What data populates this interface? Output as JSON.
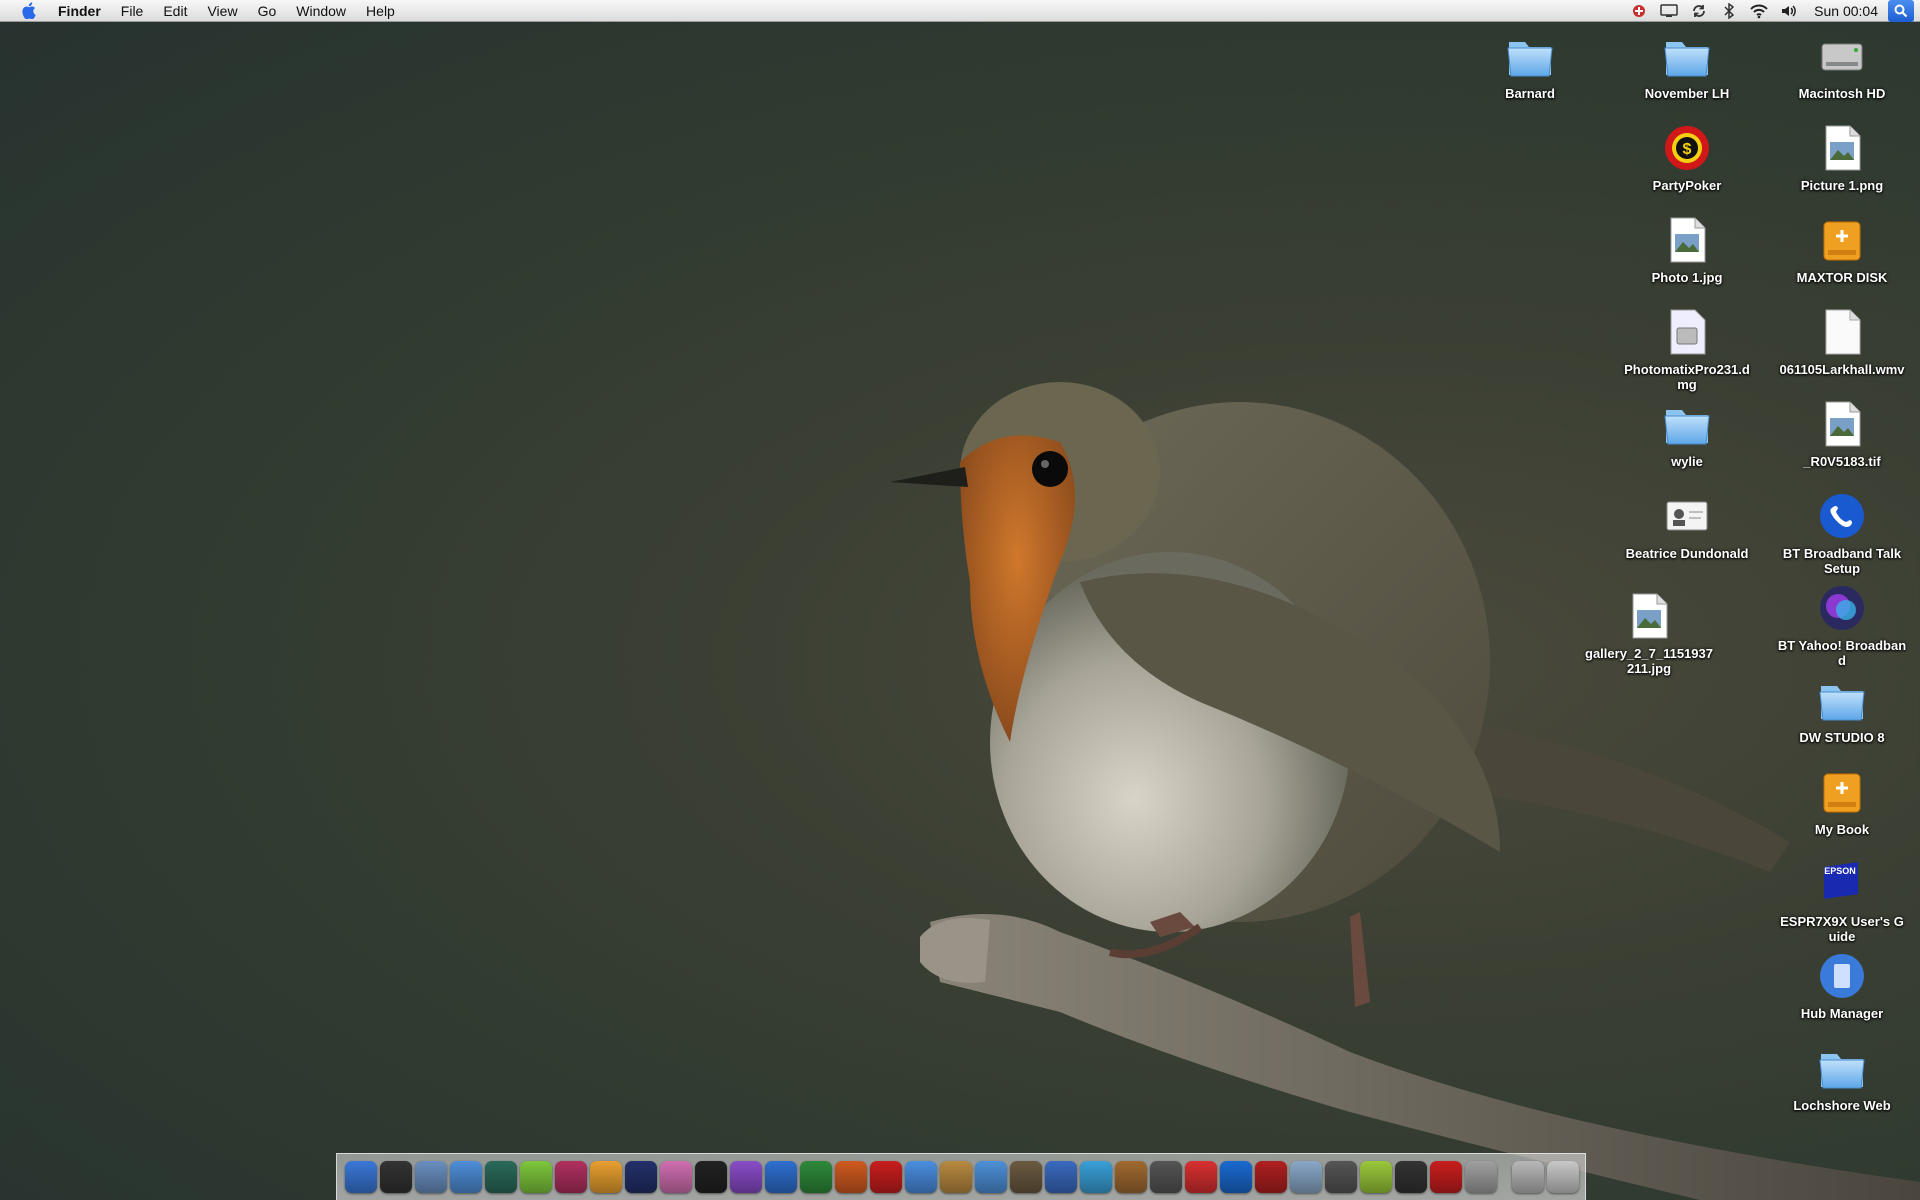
{
  "menubar": {
    "app_name": "Finder",
    "menus": [
      "File",
      "Edit",
      "View",
      "Go",
      "Window",
      "Help"
    ],
    "clock": "Sun 00:04",
    "status_icons": [
      "dashboard-status-icon",
      "display-icon",
      "sync-icon",
      "bluetooth-icon",
      "wifi-icon",
      "volume-icon"
    ]
  },
  "desktop_icons": [
    {
      "label": "Barnard",
      "icon": "folder-icon"
    },
    {
      "label": "November LH",
      "icon": "folder-icon"
    },
    {
      "label": "Macintosh HD",
      "icon": "hard-disk-icon"
    },
    {
      "label": "PartyPoker",
      "icon": "partypoker-icon"
    },
    {
      "label": "Picture 1.png",
      "icon": "png-file-icon"
    },
    {
      "label": "Photo 1.jpg",
      "icon": "jpeg-file-icon"
    },
    {
      "label": "MAXTOR DISK",
      "icon": "external-disk-icon"
    },
    {
      "label": "PhotomatixPro231.dmg",
      "icon": "disk-image-icon"
    },
    {
      "label": "061105Larkhall.wmv",
      "icon": "blank-document-icon"
    },
    {
      "label": "wylie",
      "icon": "folder-icon"
    },
    {
      "label": "_R0V5183.tif",
      "icon": "tif-file-icon"
    },
    {
      "label": "Beatrice Dundonald",
      "icon": "vcard-icon"
    },
    {
      "label": "BT Broadband Talk Setup",
      "icon": "phone-app-icon"
    },
    {
      "label": "gallery_2_7_1151937211.jpg",
      "icon": "jpeg-file-icon"
    },
    {
      "label": "BT Yahoo! Broadband",
      "icon": "bt-yahoo-icon"
    },
    {
      "label": "DW STUDIO 8",
      "icon": "folder-icon"
    },
    {
      "label": "My Book",
      "icon": "external-disk-icon"
    },
    {
      "label": "ESPR7X9X User's Guide",
      "icon": "epson-guide-icon"
    },
    {
      "label": "Hub Manager",
      "icon": "hub-manager-icon"
    },
    {
      "label": "Lochshore Web",
      "icon": "folder-icon"
    }
  ],
  "dock": {
    "items": [
      {
        "icon": "finder-icon",
        "color": "#3a78d8"
      },
      {
        "icon": "dashboard-icon",
        "color": "#333333"
      },
      {
        "icon": "mail-icon",
        "color": "#6a8fc0"
      },
      {
        "icon": "safari-icon",
        "color": "#4f8ed8"
      },
      {
        "icon": "dreamweaver-icon",
        "color": "#2a6a5a"
      },
      {
        "icon": "itunes-d-icon",
        "color": "#7ec83c"
      },
      {
        "icon": "pen-icon",
        "color": "#b03060"
      },
      {
        "icon": "iphoto-icon",
        "color": "#e8a030"
      },
      {
        "icon": "imovie-star-icon",
        "color": "#24306a"
      },
      {
        "icon": "butterfly-icon",
        "color": "#d06fb0"
      },
      {
        "icon": "camera-icon",
        "color": "#222222"
      },
      {
        "icon": "onenote-icon",
        "color": "#8a4cc8"
      },
      {
        "icon": "word-icon",
        "color": "#2e6fd0"
      },
      {
        "icon": "excel-icon",
        "color": "#2e8a3a"
      },
      {
        "icon": "powerpoint-icon",
        "color": "#d05a20"
      },
      {
        "icon": "acrobat-icon",
        "color": "#c81e1e"
      },
      {
        "icon": "ichat-icon",
        "color": "#4a8ee0"
      },
      {
        "icon": "address-book-icon",
        "color": "#b88a40"
      },
      {
        "icon": "itunes-icon",
        "color": "#4d90d8"
      },
      {
        "icon": "preview-icon",
        "color": "#6a5a40"
      },
      {
        "icon": "clapperboard-icon",
        "color": "#3a6ac0"
      },
      {
        "icon": "iweb-icon",
        "color": "#3aa0d8"
      },
      {
        "icon": "garageband-icon",
        "color": "#a06a30"
      },
      {
        "icon": "photo-booth-icon",
        "color": "#555555"
      },
      {
        "icon": "ical-icon",
        "color": "#d83030"
      },
      {
        "icon": "quicktime-icon",
        "color": "#1a6ad0"
      },
      {
        "icon": "photo-app-icon",
        "color": "#b02020"
      },
      {
        "icon": "package-icon",
        "color": "#8aa8c8"
      },
      {
        "icon": "terminal-dash-icon",
        "color": "#555555"
      },
      {
        "icon": "green-app-icon",
        "color": "#9ac83a"
      },
      {
        "icon": "monitor-icon",
        "color": "#333333"
      },
      {
        "icon": "partypoker-dock-icon",
        "color": "#c81e1e"
      },
      {
        "icon": "apple-app-icon",
        "color": "#a0a0a0"
      }
    ],
    "right_items": [
      {
        "icon": "downloads-icon",
        "color": "#b8b8b8"
      },
      {
        "icon": "trash-icon",
        "color": "#c8c8c8"
      }
    ]
  }
}
